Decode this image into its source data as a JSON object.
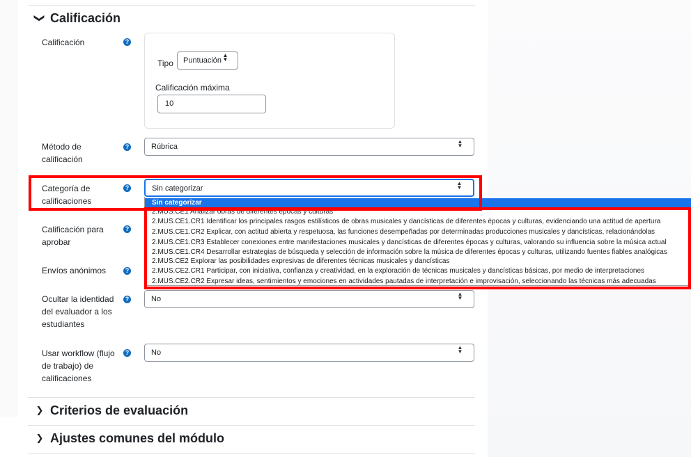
{
  "sections": {
    "grading_title": "Calificación",
    "criteria_title": "Criterios de evaluación",
    "common_title": "Ajustes comunes del módulo"
  },
  "fields": {
    "grade_label": "Calificación",
    "type_label": "Tipo",
    "type_value": "Puntuación",
    "max_grade_label": "Calificación máxima",
    "max_grade_value": "10",
    "method_label": "Método de calificación",
    "method_value": "Rúbrica",
    "category_label": "Categoría de calificaciones",
    "category_value": "Sin categorizar",
    "pass_label": "Calificación para aprobar",
    "anon_label": "Envíos anónimos",
    "hide_label": "Ocultar la identidad del evaluador a los estudiantes",
    "hide_value": "No",
    "workflow_label": "Usar workflow (flujo de trabajo) de calificaciones",
    "workflow_value": "No"
  },
  "dropdown_options": [
    "Sin categorizar",
    "2.MUS.CE1 Analizar obras de diferentes épocas y culturas",
    "2.MUS.CE1.CR1 Identificar los principales rasgos estilísticos de obras musicales y dancísticas de diferentes épocas y culturas, evidenciando una actitud de apertura",
    "2.MUS.CE1.CR2 Explicar, con actitud abierta y respetuosa, las funciones desempeñadas por determinadas producciones musicales y dancísticas, relacionándolas",
    "2.MUS.CE1.CR3 Establecer conexiones entre manifestaciones musicales y dancísticas de diferentes épocas y culturas, valorando su influencia sobre la música actual",
    "2.MUS.CE1.CR4 Desarrollar estrategias de búsqueda y selección de información sobre la música de diferentes épocas y culturas, utilizando fuentes fiables analógicas",
    "2.MUS.CE2 Explorar las posibilidades expresivas de diferentes técnicas musicales y dancísticas",
    "2.MUS.CE2.CR1 Participar, con iniciativa, confianza y creatividad, en la exploración de técnicas musicales y dancísticas básicas, por medio de interpretaciones",
    "2.MUS.CE2.CR2 Expresar ideas, sentimientos y emociones en actividades pautadas de interpretación e improvisación, seleccionando las técnicas más adecuadas"
  ],
  "icons": {
    "help": "?",
    "chevron_down": "❯",
    "chevron_right": "❯",
    "select_arrows": "▲▼"
  },
  "colors": {
    "highlight": "#ff0000",
    "selected_option": "#1a73e8",
    "help_icon": "#0f6cbf"
  }
}
